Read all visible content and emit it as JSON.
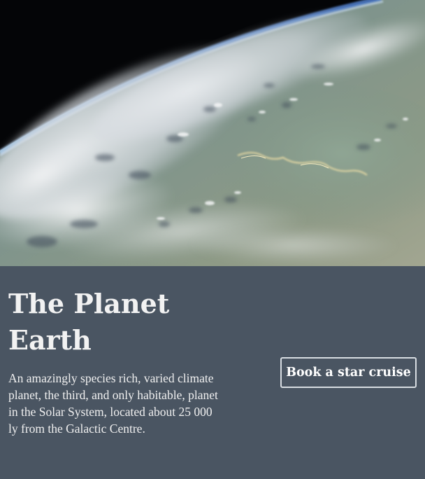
{
  "hero": {
    "image": "earth-from-orbit-photo"
  },
  "planet": {
    "title": "The Planet Earth",
    "description": "An amazingly species rich, varied climate planet, the third, and only habitable, planet in the Solar System, located about 25 000 ly from the Galactic Centre."
  },
  "actions": {
    "book_label": "Book a star cruise"
  },
  "colors": {
    "panel_background": "#4a5562",
    "text": "#f1f1f1",
    "button_border": "#d8dde2",
    "space": "#050608"
  }
}
